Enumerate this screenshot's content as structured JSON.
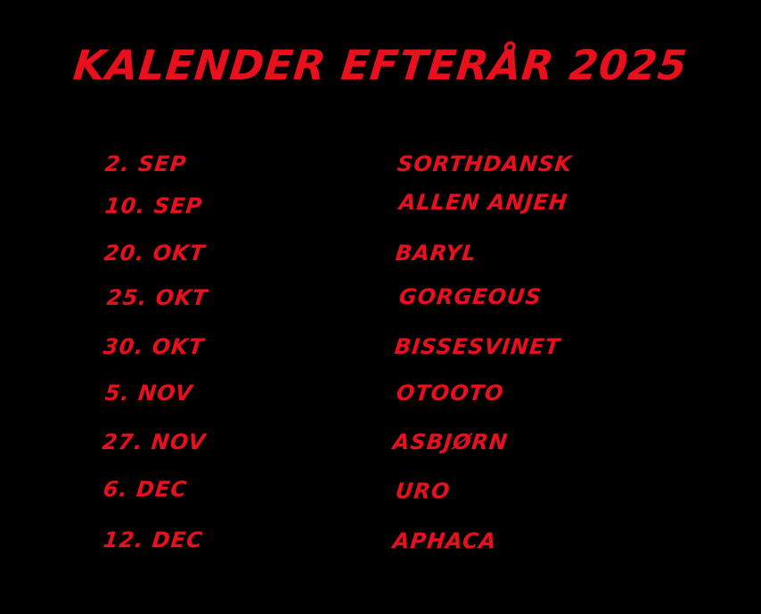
{
  "title": "KALENDER EFTERÅR 2025",
  "colors": {
    "background": "#000000",
    "text": "#e8101c"
  },
  "events": [
    {
      "date": "2. SEP",
      "artist": "SORTHDANSK"
    },
    {
      "date": "10. SEP",
      "artist": "ALLEN ANJEH"
    },
    {
      "date": "20. OKT",
      "artist": "BARYL"
    },
    {
      "date": "25. OKT",
      "artist": "GORGEOUS"
    },
    {
      "date": "30. OKT",
      "artist": "BISSESVINET"
    },
    {
      "date": "5. NOV",
      "artist": "OTOOTO"
    },
    {
      "date": "27. NOV",
      "artist": "ASBJØRN"
    },
    {
      "date": "6. DEC",
      "artist": "URO"
    },
    {
      "date": "12. DEC",
      "artist": "APHACA"
    }
  ]
}
